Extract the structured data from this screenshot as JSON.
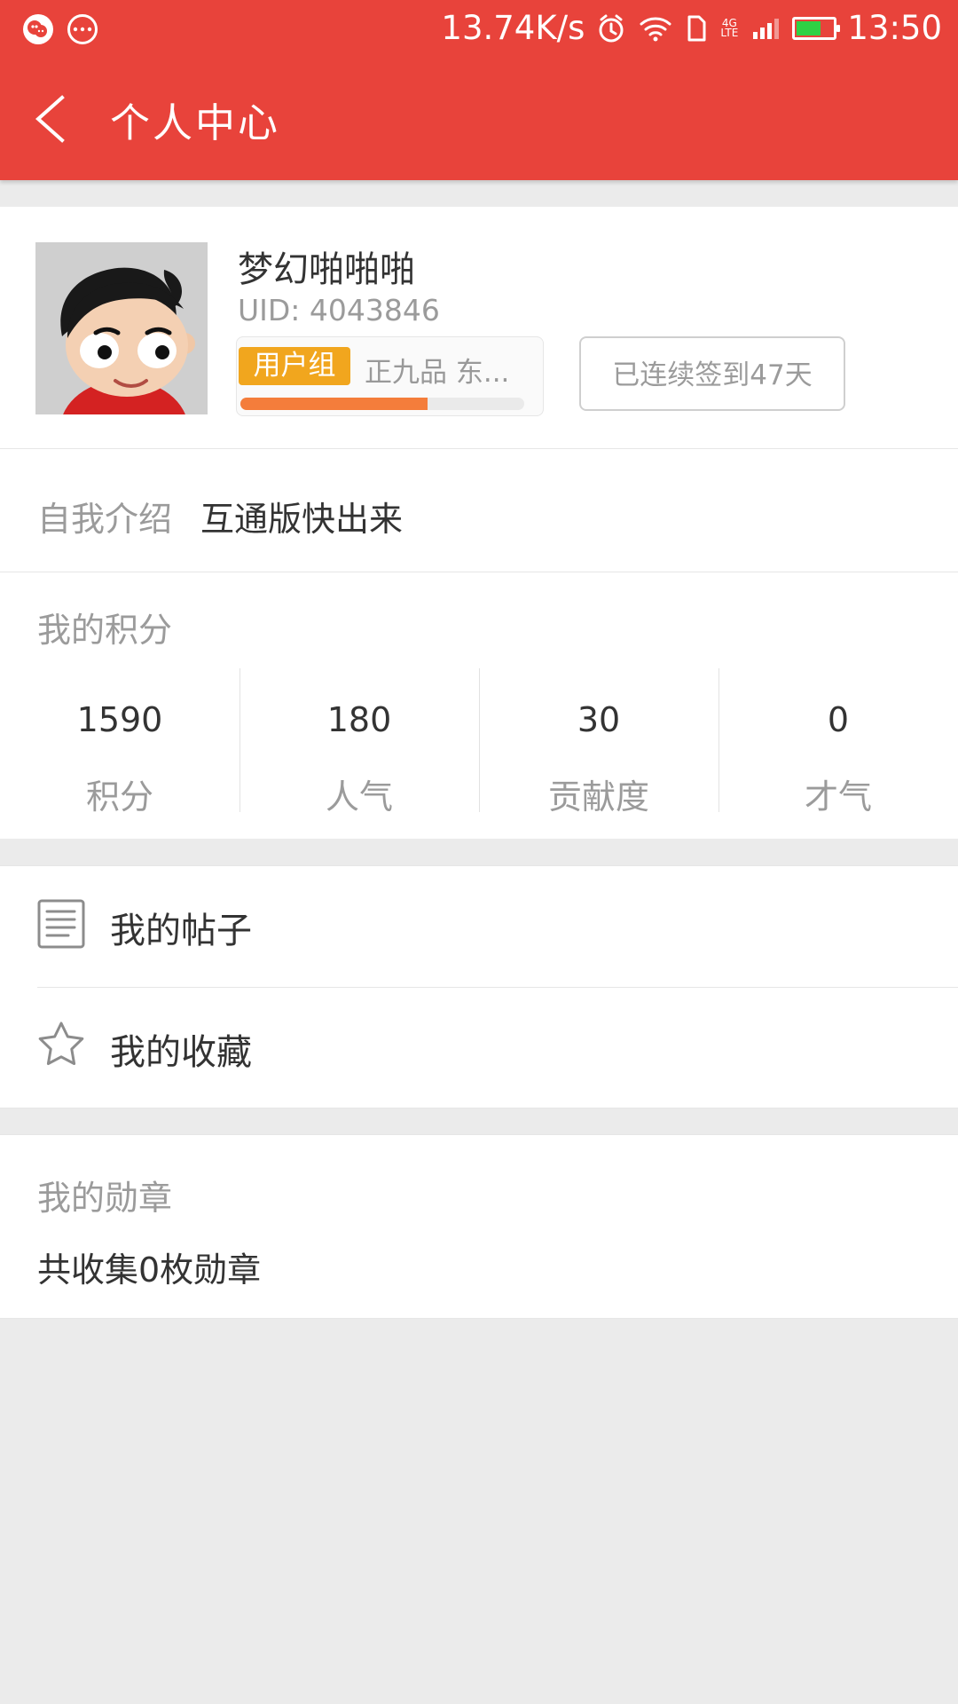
{
  "status_bar": {
    "network_speed": "13.74K/s",
    "network_type": "4G LTE",
    "time": "13:50",
    "battery_level": 0.6,
    "icons": [
      "wechat-icon",
      "more-icon",
      "alarm-icon",
      "wifi-icon",
      "sim-icon",
      "signal-icon",
      "battery-icon"
    ]
  },
  "header": {
    "title": "个人中心",
    "back_icon": "back-arrow-icon",
    "background_color": "#e8433b"
  },
  "profile": {
    "username": "梦幻啪啪啪",
    "uid": "UID: 4043846",
    "group_badge": "用户组",
    "group_text": "正九品 东...",
    "progress": 0.66,
    "checkin_label": "已连续签到47天",
    "badge_color": "#f1a61e",
    "progress_color": "#f47d3b"
  },
  "intro": {
    "label": "自我介绍",
    "value": "互通版快出来"
  },
  "points": {
    "title": "我的积分",
    "items": [
      {
        "value": "1590",
        "label": "积分"
      },
      {
        "value": "180",
        "label": "人气"
      },
      {
        "value": "30",
        "label": "贡献度"
      },
      {
        "value": "0",
        "label": "才气"
      }
    ]
  },
  "menu": {
    "items": [
      {
        "label": "我的帖子",
        "icon": "document-icon"
      },
      {
        "label": "我的收藏",
        "icon": "star-icon"
      }
    ]
  },
  "medals": {
    "title": "我的勋章",
    "text": "共收集0枚勋章"
  }
}
